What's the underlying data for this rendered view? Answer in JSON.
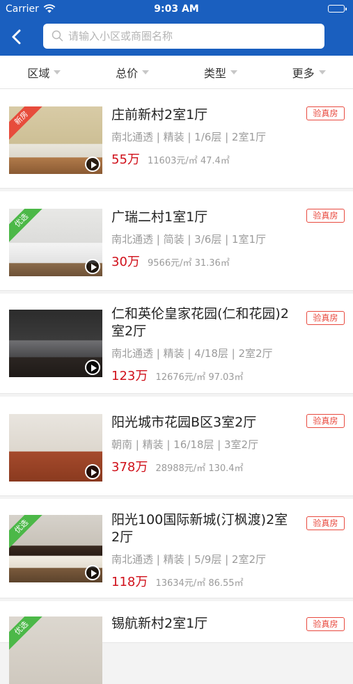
{
  "status_bar": {
    "carrier": "Carrier",
    "time": "9:03 AM"
  },
  "search": {
    "placeholder": "请输入小区或商圈名称",
    "value": ""
  },
  "filters": [
    {
      "label": "区域"
    },
    {
      "label": "总价"
    },
    {
      "label": "类型"
    },
    {
      "label": "更多"
    }
  ],
  "listings": [
    {
      "title": "庄前新村2室1厅",
      "attrs": "南北通透 | 精装 | 1/6层 | 2室1厅",
      "price": "55万",
      "unit_area": "11603元/㎡ 47.4㎡",
      "badge": "验真房",
      "tag": "新房"
    },
    {
      "title": "广瑞二村1室1厅",
      "attrs": "南北通透 | 简装 | 3/6层 | 1室1厅",
      "price": "30万",
      "unit_area": "9566元/㎡ 31.36㎡",
      "badge": "验真房",
      "tag": "优选"
    },
    {
      "title": "仁和英伦皇家花园(仁和花园)2室2厅",
      "attrs": "南北通透 | 精装 | 4/18层 | 2室2厅",
      "price": "123万",
      "unit_area": "12676元/㎡ 97.03㎡",
      "badge": "验真房",
      "tag": ""
    },
    {
      "title": "阳光城市花园B区3室2厅",
      "attrs": "朝南 | 精装 | 16/18层 | 3室2厅",
      "price": "378万",
      "unit_area": "28988元/㎡ 130.4㎡",
      "badge": "验真房",
      "tag": ""
    },
    {
      "title": "阳光100国际新城(汀枫渡)2室2厅",
      "attrs": "南北通透 | 精装 | 5/9层 | 2室2厅",
      "price": "118万",
      "unit_area": "13634元/㎡ 86.55㎡",
      "badge": "验真房",
      "tag": "优选"
    },
    {
      "title": "锡航新村2室1厅",
      "attrs": "",
      "price": "",
      "unit_area": "",
      "badge": "验真房",
      "tag": "优选"
    }
  ]
}
